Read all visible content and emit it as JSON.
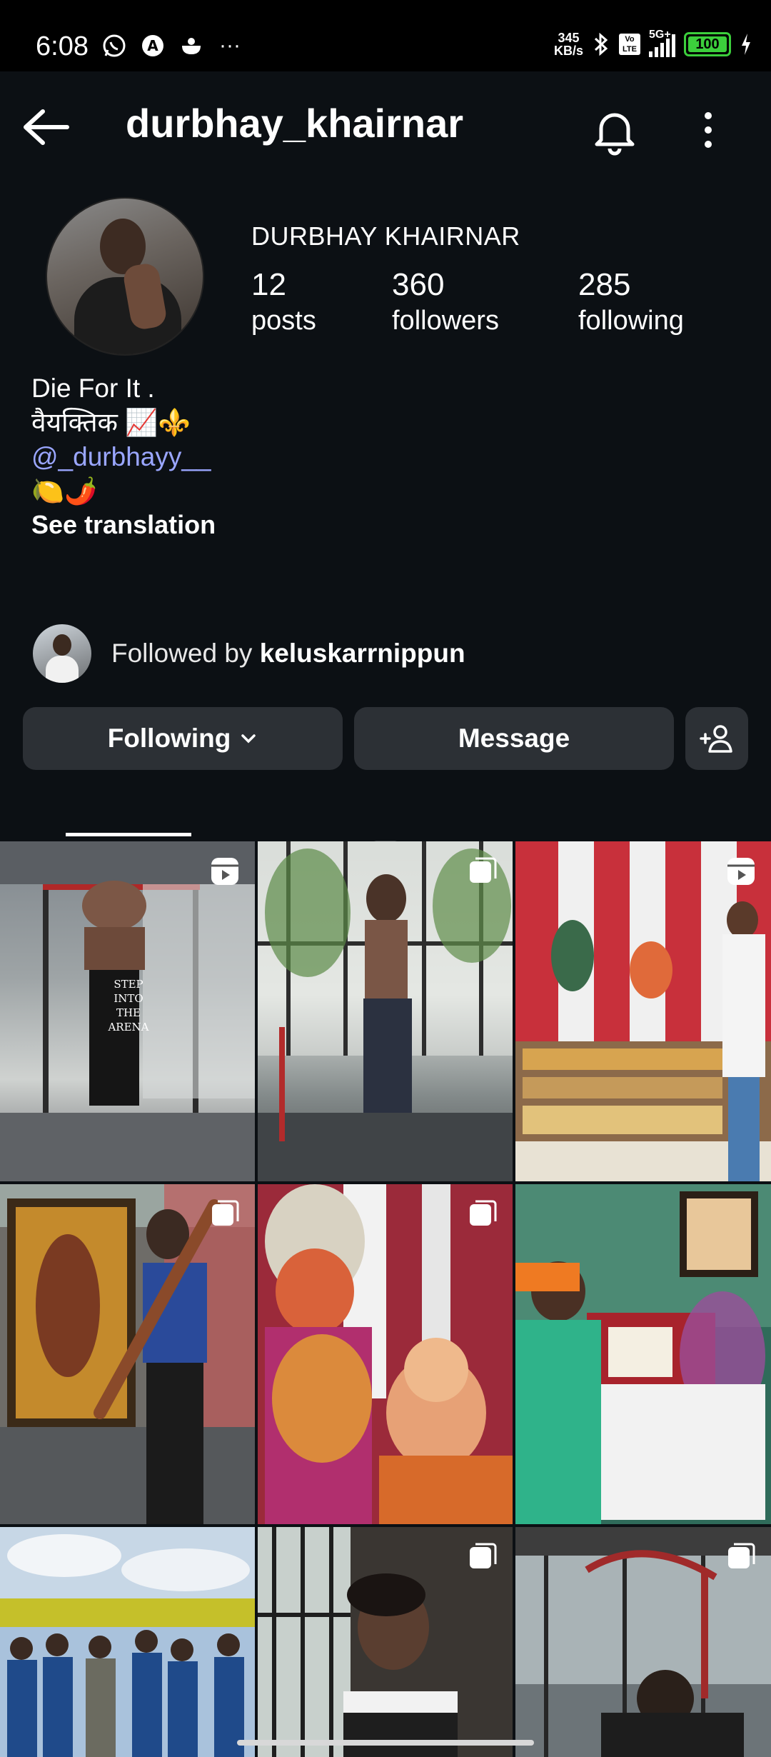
{
  "status_bar": {
    "time": "6:08",
    "network_speed_value": "345",
    "network_speed_unit": "KB/s",
    "network_type": "5G+",
    "volte": "Vo LTE",
    "battery": "100",
    "colors": {
      "battery": "#3ccf3c"
    }
  },
  "header": {
    "username": "durbhay_khairnar"
  },
  "profile": {
    "display_name": "DURBHAY KHAIRNAR",
    "stats": {
      "posts_count": "12",
      "posts_label": "posts",
      "followers_count": "360",
      "followers_label": "followers",
      "following_count": "285",
      "following_label": "following"
    },
    "bio": {
      "line1": "Die For It .",
      "line2": "वैयक्तिक 📈⚜️",
      "mention": "@_durbhayy__",
      "line4": "🍋🌶️"
    },
    "see_translation": "See translation",
    "followed_by_prefix": "Followed by ",
    "followed_by_name": "keluskarrnippun"
  },
  "actions": {
    "following_label": "Following",
    "message_label": "Message"
  },
  "tabs": [
    {
      "name": "posts-grid",
      "icon": "grid-icon",
      "active": true
    },
    {
      "name": "reels",
      "icon": "reels-icon",
      "active": false
    },
    {
      "name": "tagged",
      "icon": "tagged-icon",
      "active": false
    }
  ],
  "grid_posts": [
    {
      "type": "reel",
      "overlay_text": "STEP INTO THE ARENA"
    },
    {
      "type": "carousel"
    },
    {
      "type": "reel"
    },
    {
      "type": "carousel"
    },
    {
      "type": "carousel"
    },
    {
      "type": "photo"
    },
    {
      "type": "photo"
    },
    {
      "type": "carousel"
    },
    {
      "type": "carousel"
    }
  ],
  "colors": {
    "background": "#0c1014",
    "button": "#2c3035",
    "mention": "#9aa6ff"
  }
}
